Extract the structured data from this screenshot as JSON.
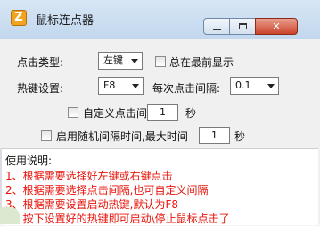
{
  "titlebar": {
    "icon_letter": "Z",
    "title": "鼠标连点器",
    "min_icon": "minimize-icon",
    "max_icon": "maximize-icon",
    "close_glyph": "✕"
  },
  "settings": {
    "click_type_label": "点击类型:",
    "click_type_value": "左键",
    "always_on_top_label": "总在最前显示",
    "always_on_top_checked": false,
    "hotkey_label": "热键设置:",
    "hotkey_value": "F8",
    "interval_label": "每次点击间隔:",
    "interval_value": "0.1",
    "custom_interval_label": "自定义点击间隔:",
    "custom_interval_checked": false,
    "custom_interval_value": "1",
    "custom_interval_unit": "秒",
    "random_interval_label": "启用随机间隔时间,最大时间",
    "random_interval_checked": false,
    "random_interval_value": "1",
    "random_interval_unit": "秒"
  },
  "help": {
    "title": "使用说明:",
    "lines": [
      "1、根据需要选择好左键或右键点击",
      "2、根据需要选择点击间隔,也可自定义间隔",
      "3、根据需要设置启动热键,默认为F8",
      "4、按下设置好的热键即可启动\\停止鼠标点击了"
    ],
    "text_color": "#e8140c"
  }
}
